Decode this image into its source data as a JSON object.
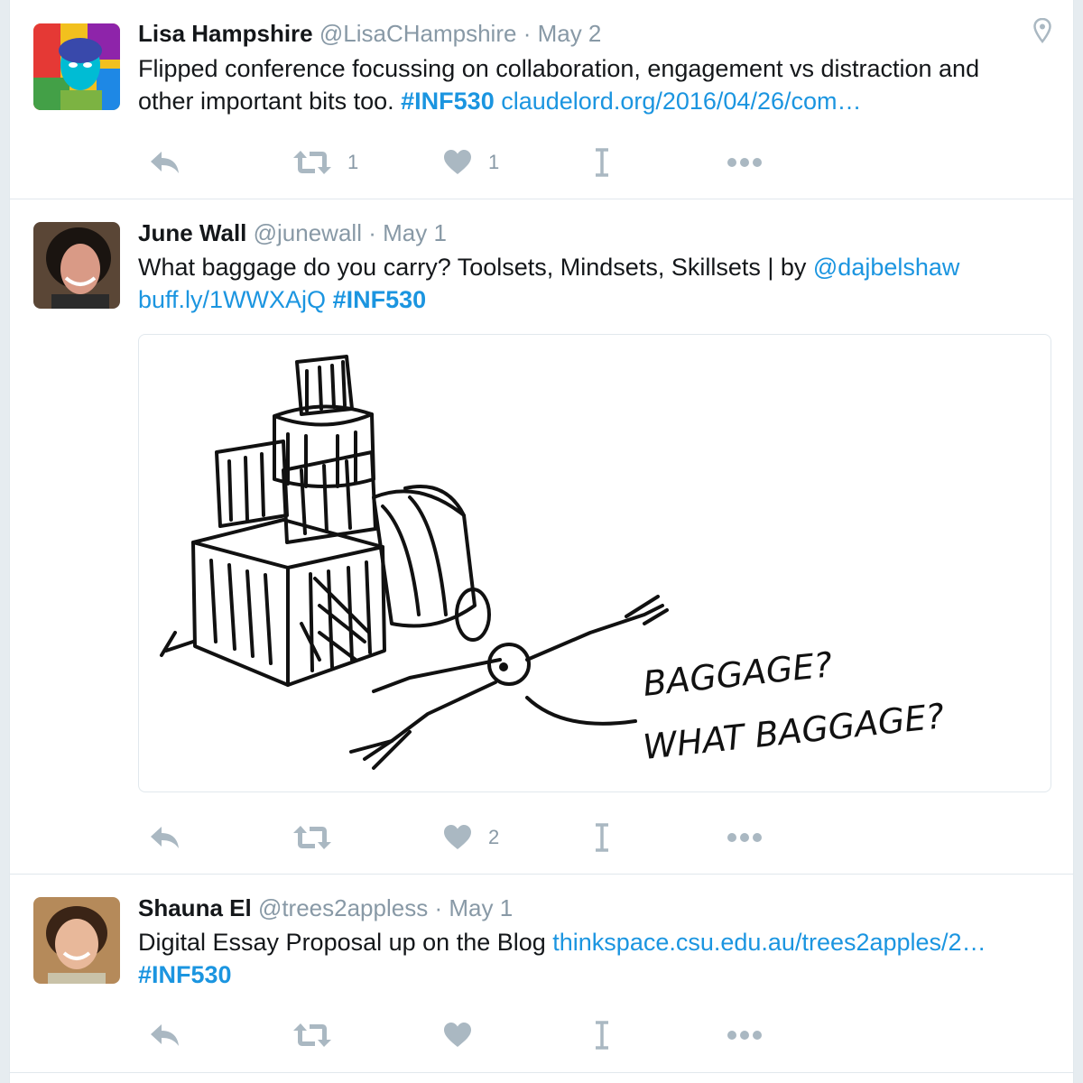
{
  "tweets": [
    {
      "name": "Lisa Hampshire",
      "handle": "@LisaCHampshire",
      "sep": "·",
      "date": "May 2",
      "text_1": "Flipped conference focussing on collaboration, engagement vs distraction and other important bits too.  ",
      "hashtag": "#INF530",
      "link": "claudelord.org/2016/04/26/com…",
      "retweets": "1",
      "likes": "1",
      "has_location_icon": true
    },
    {
      "name": "June Wall",
      "handle": "@junewall",
      "sep": "·",
      "date": "May 1",
      "text_1": "What baggage do you carry? Toolsets, Mindsets, Skillsets | by ",
      "mention": "@dajbelshaw",
      "link": "buff.ly/1WWXAjQ",
      "hashtag": "#INF530",
      "retweets": "",
      "likes": "2",
      "image_caption_line1": "BAGGAGE?",
      "image_caption_line2": "WHAT BAGGAGE?"
    },
    {
      "name": "Shauna El",
      "handle": "@trees2appless",
      "sep": "·",
      "date": "May 1",
      "text_1": "Digital Essay Proposal up on the Blog ",
      "link": "thinkspace.csu.edu.au/trees2apples/2…",
      "hashtag": "#INF530",
      "retweets": "",
      "likes": ""
    }
  ],
  "icons": [
    "reply-icon",
    "retweet-icon",
    "like-icon",
    "text-cursor-icon",
    "more-icon",
    "location-pin-icon"
  ],
  "colors": {
    "link": "#1b95e0",
    "muted": "#8899a6",
    "icon": "#aab8c2",
    "border": "#e1e8ed"
  }
}
